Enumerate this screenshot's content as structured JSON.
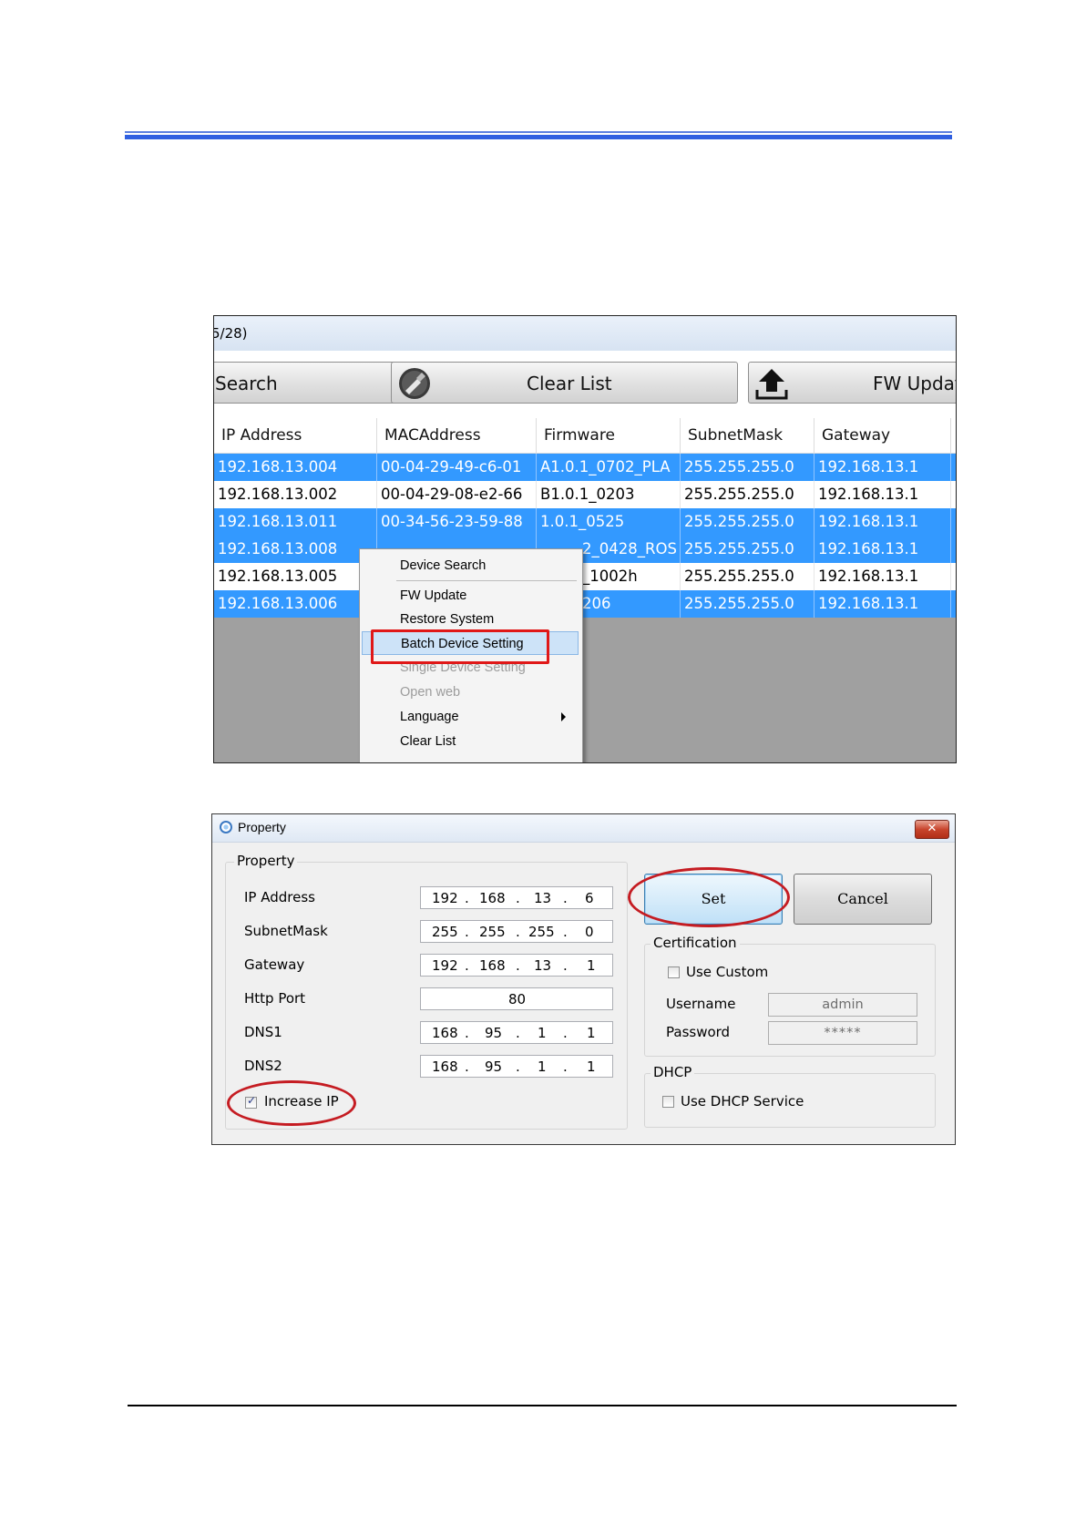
{
  "screenshot1": {
    "title_fragment": "5/28)",
    "toolbar": {
      "search_label": "Search",
      "clear_label": "Clear List",
      "fw_label": "FW Update"
    },
    "columns": [
      "IP Address",
      "MACAddress",
      "Firmware",
      "SubnetMask",
      "Gateway"
    ],
    "rows": [
      {
        "ip": "192.168.13.004",
        "mac": "00-04-29-49-c6-01",
        "fw": "A1.0.1_0702_PLA",
        "mask": "255.255.255.0",
        "gw": "192.168.13.1",
        "selected": true
      },
      {
        "ip": "192.168.13.002",
        "mac": "00-04-29-08-e2-66",
        "fw": "B1.0.1_0203",
        "mask": "255.255.255.0",
        "gw": "192.168.13.1",
        "selected": false
      },
      {
        "ip": "192.168.13.011",
        "mac": "00-34-56-23-59-88",
        "fw": "1.0.1_0525",
        "mask": "255.255.255.0",
        "gw": "192.168.13.1",
        "selected": true
      },
      {
        "ip": "192.168.13.008",
        "mac": "",
        "fw": "2_0428_ROS",
        "mask": "255.255.255.0",
        "gw": "192.168.13.1",
        "selected": true
      },
      {
        "ip": "192.168.13.005",
        "mac": "",
        "fw": "_1002h",
        "mask": "255.255.255.0",
        "gw": "192.168.13.1",
        "selected": false
      },
      {
        "ip": "192.168.13.006",
        "mac": "",
        "fw": "206",
        "mask": "255.255.255.0",
        "gw": "192.168.13.1",
        "selected": true
      }
    ],
    "context_menu": {
      "items": [
        {
          "label": "Device Search",
          "disabled": false
        },
        {
          "label": "FW Update",
          "disabled": false
        },
        {
          "label": "Restore System",
          "disabled": false
        },
        {
          "label": "Batch Device Setting",
          "disabled": false,
          "highlighted": true
        },
        {
          "label": "Single Device Setting",
          "disabled": true
        },
        {
          "label": "Open web",
          "disabled": true
        },
        {
          "label": "Language",
          "disabled": false,
          "submenu": true
        },
        {
          "label": "Clear List",
          "disabled": false
        }
      ]
    },
    "colors": {
      "selection": "#3399ff",
      "annotation": "#e01818"
    }
  },
  "screenshot2": {
    "window_title": "Property",
    "close_glyph": "✕",
    "property_group": {
      "label": "Property",
      "fields": [
        {
          "label": "IP Address",
          "value": [
            "192",
            "168",
            "13",
            "6"
          ]
        },
        {
          "label": "SubnetMask",
          "value": [
            "255",
            "255",
            "255",
            "0"
          ]
        },
        {
          "label": "Gateway",
          "value": [
            "192",
            "168",
            "13",
            "1"
          ]
        },
        {
          "label": "Http Port",
          "value": "80"
        },
        {
          "label": "DNS1",
          "value": [
            "168",
            "95",
            "1",
            "1"
          ]
        },
        {
          "label": "DNS2",
          "value": [
            "168",
            "95",
            "1",
            "1"
          ]
        }
      ],
      "increase_ip_label": "Increase IP",
      "increase_ip_checked": true
    },
    "buttons": {
      "set": "Set",
      "cancel": "Cancel"
    },
    "certification": {
      "label": "Certification",
      "use_custom_label": "Use Custom",
      "use_custom_checked": false,
      "username_label": "Username",
      "username_value": "admin",
      "password_label": "Password",
      "password_value": "*****"
    },
    "dhcp": {
      "label": "DHCP",
      "use_dhcp_label": "Use DHCP Service",
      "use_dhcp_checked": false
    },
    "colors": {
      "annotation": "#c51c22"
    }
  }
}
